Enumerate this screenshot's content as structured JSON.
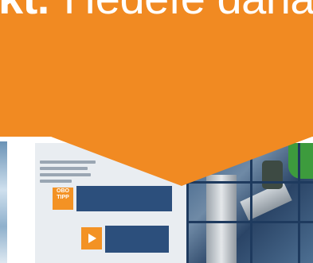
{
  "headline": {
    "bold_part": "kt.",
    "light_part": "Hedefe daha"
  },
  "brochure": {
    "badge_text": "OBO TIPP"
  },
  "colors": {
    "accent_orange": "#f18a22",
    "brochure_blue": "#16345a"
  }
}
